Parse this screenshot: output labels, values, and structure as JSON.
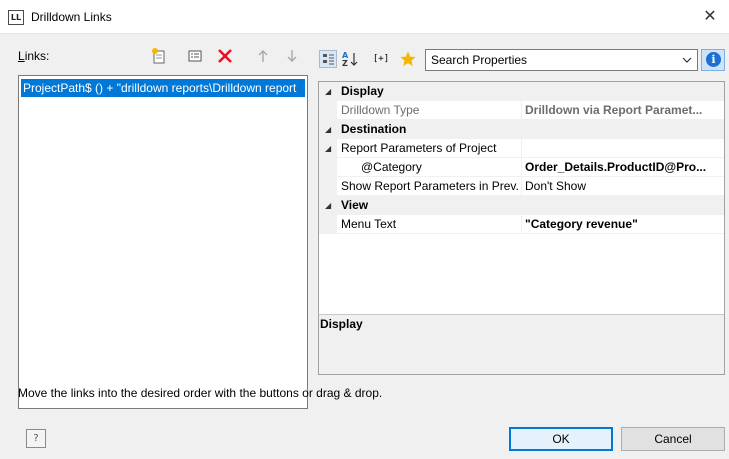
{
  "window": {
    "title": "Drilldown Links",
    "app_icon_text": "LL",
    "close_glyph": "✕"
  },
  "links": {
    "label_prefix": "L",
    "label_rest": "inks:",
    "toolbar_icons": [
      "new-link-icon",
      "edit-formula-icon",
      "delete-icon",
      "move-up-icon",
      "move-down-icon"
    ],
    "items": [
      {
        "text": "ProjectPath$ () + \"drilldown reports\\Drilldown report"
      }
    ]
  },
  "properties": {
    "toolbar_icons": [
      "categorized-view-icon",
      "sort-alphabetical-icon",
      "expand-collapse-icon",
      "favorites-star-icon"
    ],
    "expand_icon_text": "[+]",
    "search_placeholder": "Search Properties",
    "info_glyph": "i",
    "rows": [
      {
        "kind": "category",
        "name": "Display"
      },
      {
        "kind": "prop",
        "name": "Drilldown Type",
        "value": "Drilldown via Report Paramet...",
        "muted": true,
        "value_bold": true,
        "indent": false
      },
      {
        "kind": "category",
        "name": "Destination"
      },
      {
        "kind": "subcategory",
        "name": "Report Parameters of Project",
        "value": ""
      },
      {
        "kind": "prop",
        "name": "@Category",
        "value": "Order_Details.ProductID@Pro...",
        "muted": false,
        "value_bold": true,
        "indent": true
      },
      {
        "kind": "prop",
        "name": "Show Report Parameters in Prev...",
        "value": "Don't Show",
        "muted": false,
        "value_bold": false,
        "indent": false
      },
      {
        "kind": "category",
        "name": "View"
      },
      {
        "kind": "prop",
        "name": "Menu Text",
        "value": "\"Category revenue\"",
        "muted": false,
        "value_bold": true,
        "indent": false
      }
    ],
    "description_title": "Display"
  },
  "footer": {
    "hint": "Move the links into the desired order with the buttons or drag & drop.",
    "help_glyph": "?",
    "ok_label": "OK",
    "cancel_label": "Cancel"
  },
  "colors": {
    "selection": "#0078d7",
    "delete_red": "#e81123",
    "info_blue": "#1e6fd0",
    "star": "#f5b800"
  }
}
